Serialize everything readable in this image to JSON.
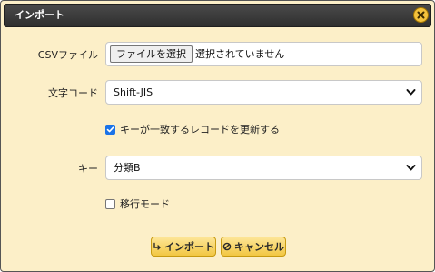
{
  "dialog": {
    "title": "インポート",
    "close_icon": "close-icon"
  },
  "form": {
    "csv_label": "CSVファイル",
    "file_button_label": "ファイルを選択",
    "file_status": "選択されていません",
    "encoding_label": "文字コード",
    "encoding_value": "Shift-JIS",
    "update_checkbox_label": "キーが一致するレコードを更新する",
    "update_checked": true,
    "key_label": "キー",
    "key_value": "分類B",
    "migration_checkbox_label": "移行モード",
    "migration_checked": false
  },
  "buttons": {
    "import_label": "インポート",
    "import_icon": "import-arrow-icon",
    "cancel_label": "キャンセル",
    "cancel_icon": "cancel-icon"
  },
  "colors": {
    "dialog_bg": "#fcefc8",
    "titlebar": "#3a3a3a",
    "button_bg": "#f2c743",
    "checkbox_checked": "#1a73e8"
  }
}
